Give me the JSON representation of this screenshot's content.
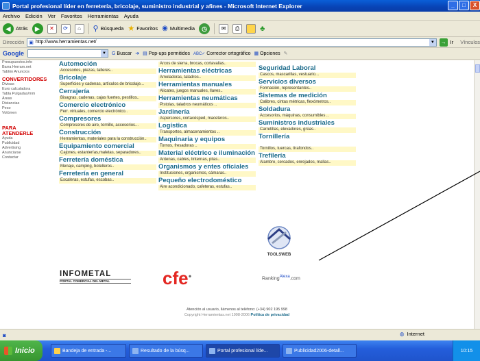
{
  "window": {
    "title": "Portal profesional líder en ferretería, bricolaje, suministro industrial y afines - Microsoft Internet Explorer",
    "minimize": "_",
    "maximize": "□",
    "close": "X"
  },
  "menu": [
    "Archivo",
    "Edición",
    "Ver",
    "Favoritos",
    "Herramientas",
    "Ayuda"
  ],
  "toolbar": {
    "back": "Atrás",
    "search": "Búsqueda",
    "favorites": "Favoritos",
    "multimedia": "Multimedia"
  },
  "address": {
    "label": "Dirección",
    "url": "http://www.herramientas.net/",
    "go": "Ir",
    "links": "Vínculos"
  },
  "googlebar": {
    "logo": "Google",
    "search": "Buscar",
    "popups": "Pop-ups permitidos",
    "spell": "Corrector ortográfico",
    "options": "Opciones"
  },
  "sidebar": {
    "top_items": [
      "Presupuestos.info",
      "Barra Herram.net",
      "Tablón Anuncios"
    ],
    "convert_head": "CONVERTIDORES",
    "convert_items": [
      "Divisas",
      "Euro calculadora",
      "Tabla Pulgadas/mm",
      "Áreas",
      "Distancias",
      "Peso",
      "Volúmen"
    ],
    "attend_head_1": "PARA",
    "attend_head_2": "ATENDERLE",
    "attend_items": [
      "Ayuda",
      "Publicidad",
      "Advertising",
      "Anunciarse",
      "Contactar"
    ]
  },
  "columns": [
    [
      {
        "cat": "Automoción",
        "desc": "Accesorios, piezas, talleres.."
      },
      {
        "cat": "Bricolaje",
        "desc": "Superficies y cadenas, artículos de bricolaje..."
      },
      {
        "cat": "Cerrajería",
        "desc": "Bisagras, cadenas, cajas fuertes, pestillos.."
      },
      {
        "cat": "Comercio electrónico",
        "desc": "Ferr. virtuales, comercio electrónico.."
      },
      {
        "cat": "Compresores",
        "desc": "Compresores de aire, tornillo, accesorios..."
      },
      {
        "cat": "Construcción",
        "desc": "Herramientas, materiales para la construcción.."
      },
      {
        "cat": "Equipamiento comercial",
        "desc": "Cajones, estanterías,maletas, separadores.."
      },
      {
        "cat": "Ferretería doméstica",
        "desc": "Menaje, camping, botelleros.."
      },
      {
        "cat": "Ferretería en general",
        "desc": "Escaleras, estufas, escobas.."
      }
    ],
    [
      {
        "cat": "",
        "desc": "Arcos de sierra, brocas, cortavallas.."
      },
      {
        "cat": "Herramientas eléctricas",
        "desc": "Amoladoras, taladros.."
      },
      {
        "cat": "Herramientas manuales",
        "desc": "Alicates, juegos manuales, llaves.."
      },
      {
        "cat": "Herramientas neumáticas",
        "desc": "Pistolas, taladros neumáticos .."
      },
      {
        "cat": "Jardinería",
        "desc": "Aspersores, cortacésped, maceteros.."
      },
      {
        "cat": "Logística",
        "desc": "Transportes, almacenamientos .."
      },
      {
        "cat": "Maquinaria y equipos",
        "desc": "Tornos, fresadoras .."
      },
      {
        "cat": "Material eléctrico e iluminación",
        "desc": "Antenas, cables, linternas, pilas.."
      },
      {
        "cat": "Organismos y entes oficiales",
        "desc": "Instituciones, organismos, cámaras.."
      },
      {
        "cat": "Pequeño electrodoméstico",
        "desc": "Aire acondicionado, cafeteras, estufas.."
      }
    ],
    [
      {
        "cat": "Seguridad Laboral",
        "desc": "Cascos, mascarillas, vestuario..."
      },
      {
        "cat": "Servicios diversos",
        "desc": "Formación, representantes.."
      },
      {
        "cat": "Sistemas de medición",
        "desc": "Calibres, cintas métricas, flexómetros.."
      },
      {
        "cat": "Soldadura",
        "desc": "Accesorios, máquinas, consumibles .."
      },
      {
        "cat": "Suministros industriales",
        "desc": "Carretillas, elevadores, grúas.."
      },
      {
        "cat": "Tornillería",
        "desc": "Tornillos, tuercas, tirafondos.."
      },
      {
        "cat": "Trefilería",
        "desc": "Alambre, cercados, enrejados, mallas.."
      }
    ]
  ],
  "logos": {
    "infometal": "INFOMETAL",
    "infometal_sub": "PORTAL COMERCIAL DEL METAL",
    "cfe": "CFE",
    "ranking": "Ranking",
    "ranking_alexa": "Alexa",
    "ranking_com": ".com",
    "toolsweb": "TOOLSWEB"
  },
  "footer": {
    "line1": "Atención al usuario, llámenos al teléfono: (+34) 902 195 998",
    "line2_a": "Copyright Herramientas.net 1998-2006",
    "line2_b": "Política de privacidad"
  },
  "status": {
    "zone": "Internet"
  },
  "taskbar": {
    "start": "Inicio",
    "tasks": [
      "Bandeja de entrada -...",
      "Resultado de la búsq...",
      "Portal profesional líde...",
      "Publicidad2006-detall..."
    ],
    "clock": "10:15"
  }
}
